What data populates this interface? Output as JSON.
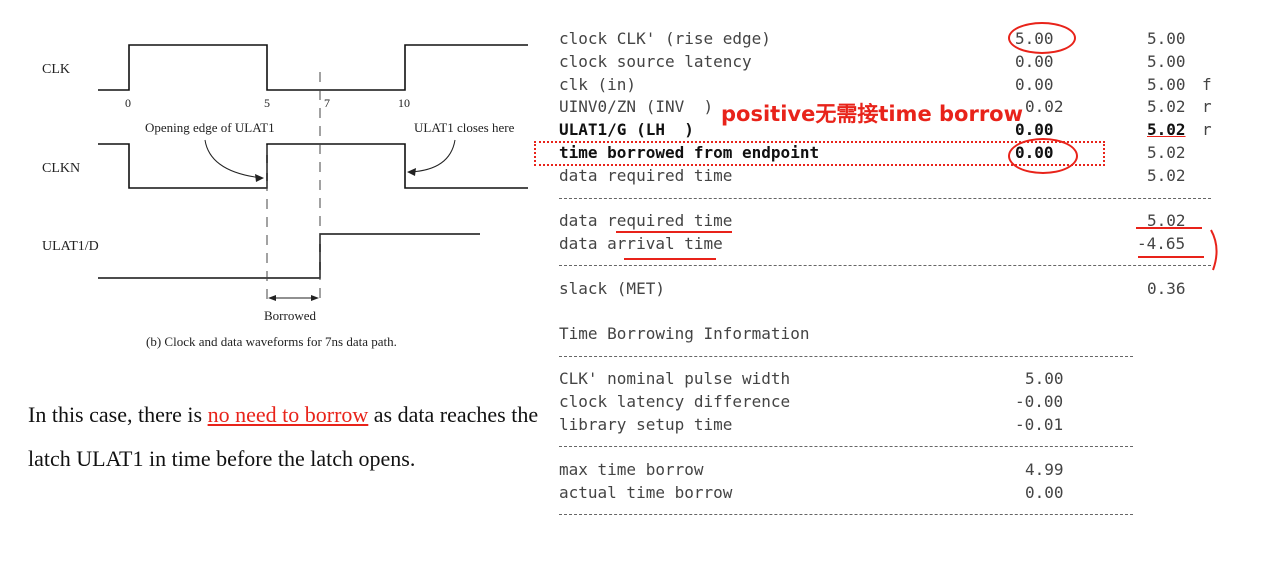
{
  "diagram": {
    "signals": [
      "CLK",
      "CLKN",
      "ULAT1/D"
    ],
    "ticks": [
      "0",
      "5",
      "7",
      "10"
    ],
    "annot_open": "Opening edge of ULAT1",
    "annot_close": "ULAT1 closes here",
    "borrowed": "Borrowed",
    "caption": "(b) Clock and data waveforms for 7ns data path."
  },
  "paragraph": {
    "before": "In this case, there is ",
    "highlight": "no need to borrow",
    "after": " as data reaches the latch ULAT1 in time before the latch opens."
  },
  "note": "positive无需接time borrow",
  "report": {
    "rows": [
      {
        "label": "clock CLK' (rise edge)",
        "incr": "5.00",
        "path": "5.00",
        "flag": ""
      },
      {
        "label": "clock source latency",
        "incr": "0.00",
        "path": "5.00",
        "flag": ""
      },
      {
        "label": "clk (in)",
        "incr": "0.00",
        "path": "5.00",
        "flag": "f"
      },
      {
        "label": "UINV0/ZN (INV  )",
        "incr": "0.02",
        "path": "5.02",
        "flag": "r"
      },
      {
        "label": "ULAT1/G (LH  )",
        "incr": "0.00",
        "path": "5.02",
        "flag": "r"
      },
      {
        "label": "time borrowed from endpoint",
        "incr": "0.00",
        "path": "5.02",
        "flag": ""
      },
      {
        "label": "data required time",
        "incr": "",
        "path": "5.02",
        "flag": ""
      }
    ],
    "summary": [
      {
        "label": "data required time",
        "value": "5.02"
      },
      {
        "label": "data arrival time",
        "value": "-4.65"
      }
    ],
    "slack_label": "slack (MET)",
    "slack_value": "0.36",
    "tb_title": "Time Borrowing Information",
    "tb_rows": [
      {
        "label": "CLK' nominal pulse width",
        "value": "5.00"
      },
      {
        "label": "clock latency difference",
        "value": "-0.00"
      },
      {
        "label": "library setup time",
        "value": "-0.01"
      }
    ],
    "tb_rows2": [
      {
        "label": "max time borrow",
        "value": "4.99"
      },
      {
        "label": "actual time borrow",
        "value": "0.00"
      }
    ]
  }
}
